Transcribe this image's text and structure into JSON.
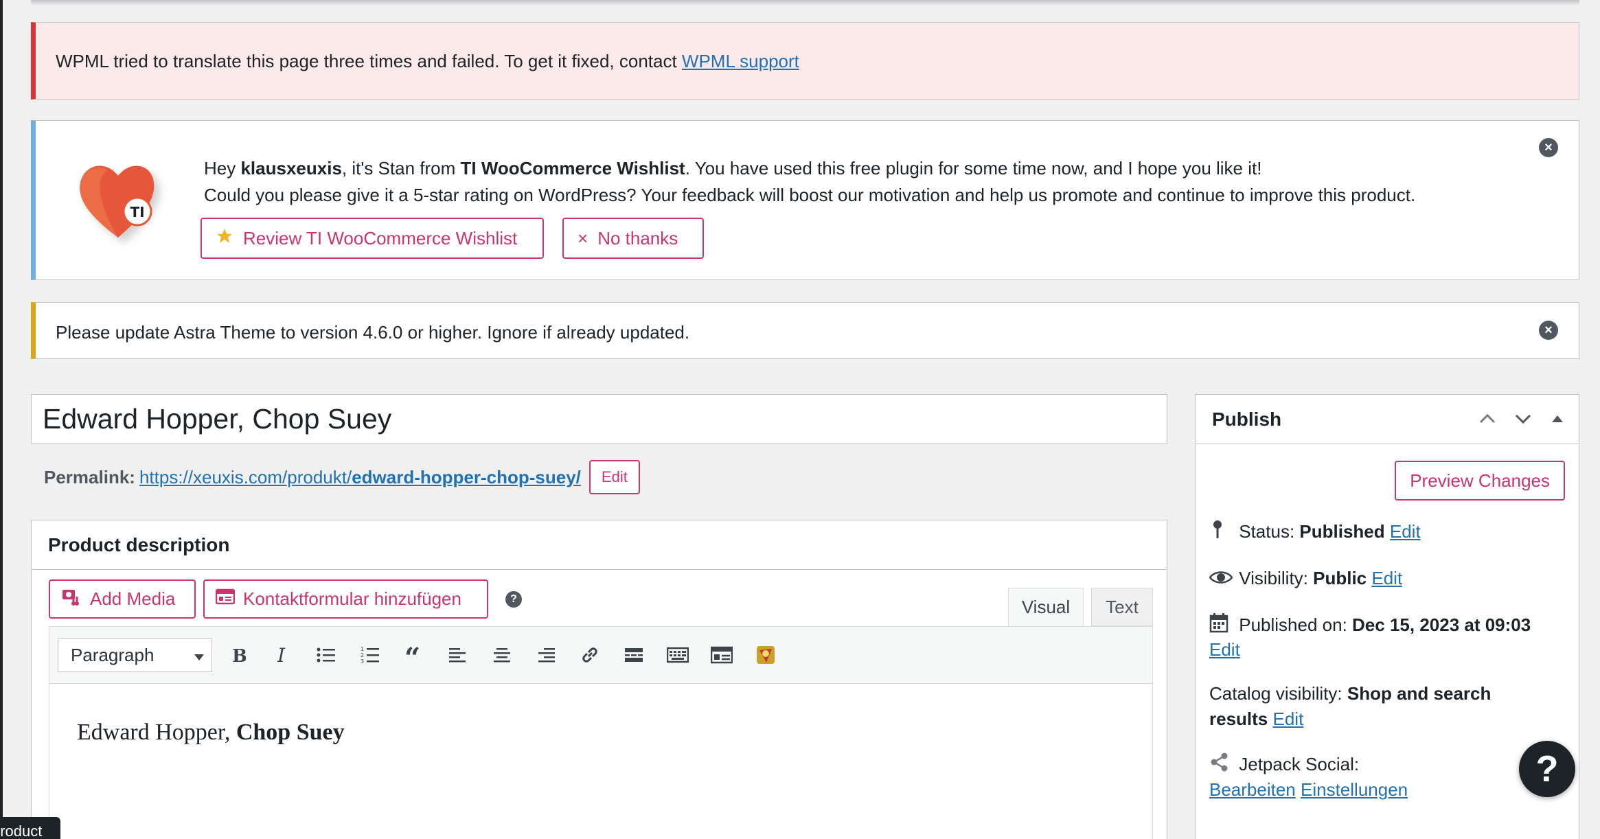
{
  "notices": {
    "wpml": {
      "message": "WPML tried to translate this page three times and failed. To get it fixed, contact ",
      "link": "WPML support"
    },
    "ti_wishlist": {
      "line1_pre": "Hey ",
      "user": "klausxeuxis",
      "line1_mid": ", it's Stan from ",
      "plugin": "TI WooCommerce Wishlist",
      "line1_post": ". You have used this free plugin for some time now, and I hope you like it!",
      "line2": "Could you please give it a 5-star rating on WordPress? Your feedback will boost our motivation and help us promote and continue to improve this product.",
      "review_label": "Review TI WooCommerce Wishlist",
      "nothanks_label": "No thanks",
      "logo_text": "TI"
    },
    "astra": {
      "message": "Please update Astra Theme to version 4.6.0 or higher. Ignore if already updated."
    }
  },
  "post": {
    "title": "Edward Hopper, Chop Suey",
    "permalink_label": "Permalink:",
    "permalink_base": "https://xeuxis.com/produkt/",
    "permalink_slug": "edward-hopper-chop-suey/",
    "permalink_edit": "Edit"
  },
  "description": {
    "heading": "Product description",
    "add_media": "Add Media",
    "kontakt": "Kontaktformular hinzufügen",
    "tab_visual": "Visual",
    "tab_text": "Text",
    "format": "Paragraph",
    "content_plain": "Edward Hopper, ",
    "content_bold": "Chop Suey"
  },
  "publish": {
    "heading": "Publish",
    "preview": "Preview Changes",
    "status_label": "Status: ",
    "status_value": "Published",
    "visibility_label": "Visibility: ",
    "visibility_value": "Public",
    "published_label": "Published on: ",
    "published_value": "Dec 15, 2023 at 09:03",
    "catalog_label": "Catalog visibility: ",
    "catalog_value1": "Shop and search",
    "catalog_value2": "results",
    "jetpack_label": "Jetpack Social:",
    "bearbeiten": "Bearbeiten",
    "einstellungen": "Einstellungen",
    "edit": "Edit"
  },
  "tooltip": "product",
  "help_fab": "?",
  "colors": {
    "accent": "#c9356e",
    "link": "#2271b1",
    "error": "#d63638",
    "info": "#72aee6",
    "warning": "#dba617"
  }
}
